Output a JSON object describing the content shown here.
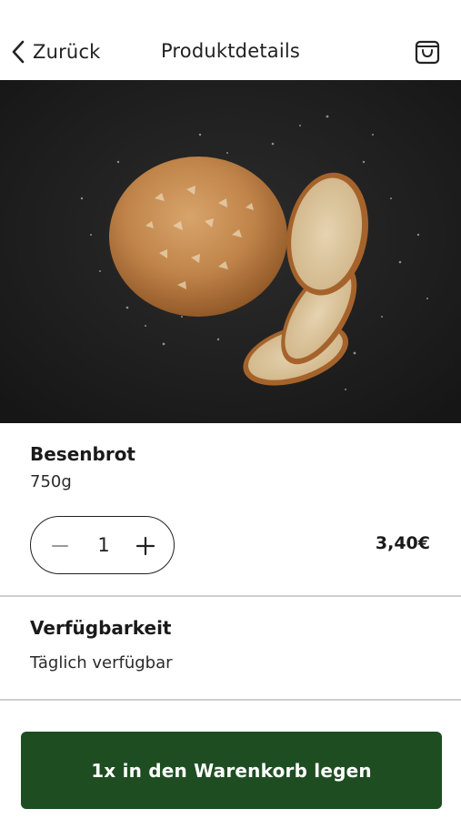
{
  "header": {
    "back_label": "Zurück",
    "title": "Produktdetails",
    "cart_icon": "shopping-bag-icon"
  },
  "product": {
    "name": "Besenbrot",
    "weight": "750g",
    "quantity": "1",
    "price": "3,40€"
  },
  "availability": {
    "title": "Verfügbarkeit",
    "text": "Täglich verfügbar"
  },
  "cta": {
    "label": "1x in den Warenkorb legen"
  },
  "colors": {
    "accent": "#1e4d21",
    "hero_background": "#1c1c1c",
    "divider": "#cfcfcf"
  }
}
